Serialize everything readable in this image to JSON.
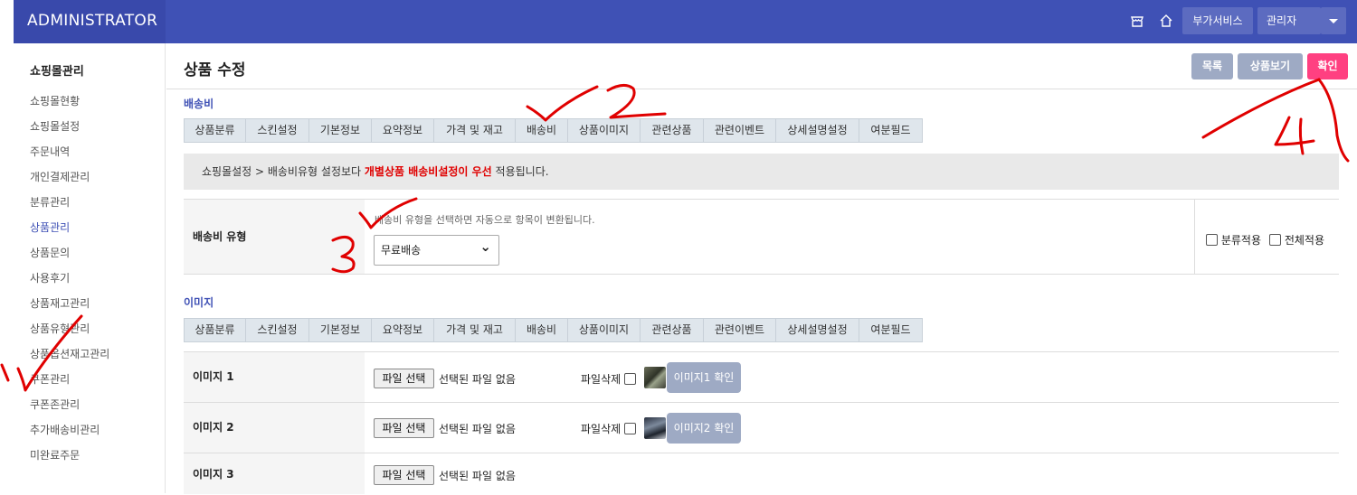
{
  "app": {
    "brand": "ADMINISTRATOR"
  },
  "topbar": {
    "addon_label": "부가서비스",
    "admin_label": "관리자"
  },
  "sidebar": {
    "title": "쇼핑몰관리",
    "items": [
      {
        "label": "쇼핑몰현황"
      },
      {
        "label": "쇼핑몰설정"
      },
      {
        "label": "주문내역"
      },
      {
        "label": "개인결제관리"
      },
      {
        "label": "분류관리"
      },
      {
        "label": "상품관리",
        "active": true
      },
      {
        "label": "상품문의"
      },
      {
        "label": "사용후기"
      },
      {
        "label": "상품재고관리"
      },
      {
        "label": "상품유형관리"
      },
      {
        "label": "상품옵션재고관리"
      },
      {
        "label": "쿠폰관리"
      },
      {
        "label": "쿠폰존관리"
      },
      {
        "label": "추가배송비관리"
      },
      {
        "label": "미완료주문"
      }
    ]
  },
  "header": {
    "title": "상품 수정",
    "list_button": "목록",
    "view_button": "상품보기",
    "confirm_button": "확인"
  },
  "tabs": [
    "상품분류",
    "스킨설정",
    "기본정보",
    "요약정보",
    "가격 및 재고",
    "배송비",
    "상품이미지",
    "관련상품",
    "관련이벤트",
    "상세설명설정",
    "여분필드"
  ],
  "shipping": {
    "section_title": "배송비",
    "notice_prefix": "쇼핑몰설정 > 배송비유형 설정보다 ",
    "notice_highlight": "개별상품 배송비설정이 우선",
    "notice_suffix": " 적용됩니다.",
    "type_label": "배송비 유형",
    "help_text": "배송비 유형을 선택하면 자동으로 항목이 변환됩니다.",
    "selected_value": "무료배송",
    "apply_category": "분류적용",
    "apply_all": "전체적용"
  },
  "images": {
    "section_title": "이미지",
    "file_button": "파일 선택",
    "no_file": "선택된 파일 없음",
    "delete_label": "파일삭제",
    "rows": [
      {
        "label": "이미지 1",
        "confirm": "이미지1 확인"
      },
      {
        "label": "이미지 2",
        "confirm": "이미지2 확인"
      },
      {
        "label": "이미지 3"
      }
    ]
  },
  "annotations": [
    "1",
    "2",
    "3",
    "4"
  ],
  "colors": {
    "primary": "#3f51b5",
    "brand_bg": "#3949ab",
    "confirm": "#ff4081",
    "muted_button": "#9eaac4",
    "annotation": "#e00000"
  }
}
